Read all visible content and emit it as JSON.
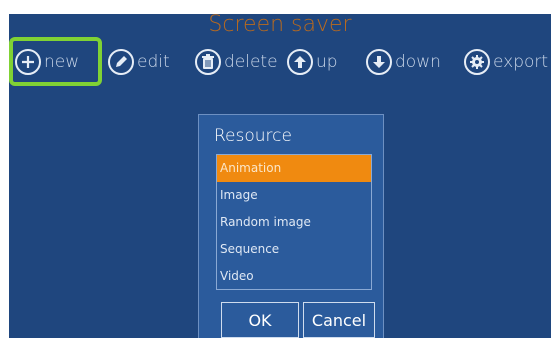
{
  "app": {
    "title": "Screen saver"
  },
  "toolbar": {
    "items": [
      {
        "label": "new",
        "icon": "plus-icon"
      },
      {
        "label": "edit",
        "icon": "pencil-icon"
      },
      {
        "label": "delete",
        "icon": "trash-icon"
      },
      {
        "label": "up",
        "icon": "arrow-up-icon"
      },
      {
        "label": "down",
        "icon": "arrow-down-icon"
      },
      {
        "label": "export",
        "icon": "gear-icon"
      }
    ]
  },
  "colors": {
    "background": "#1f467e",
    "title": "#b96a1e",
    "highlight": "#80d234",
    "selected": "#f08a10",
    "dialog": "#2b5b9c"
  },
  "dialog": {
    "title": "Resource",
    "items": [
      {
        "label": "Animation",
        "selected": true
      },
      {
        "label": "Image",
        "selected": false
      },
      {
        "label": "Random image",
        "selected": false
      },
      {
        "label": "Sequence",
        "selected": false
      },
      {
        "label": "Video",
        "selected": false
      }
    ],
    "ok_label": "OK",
    "cancel_label": "Cancel"
  }
}
